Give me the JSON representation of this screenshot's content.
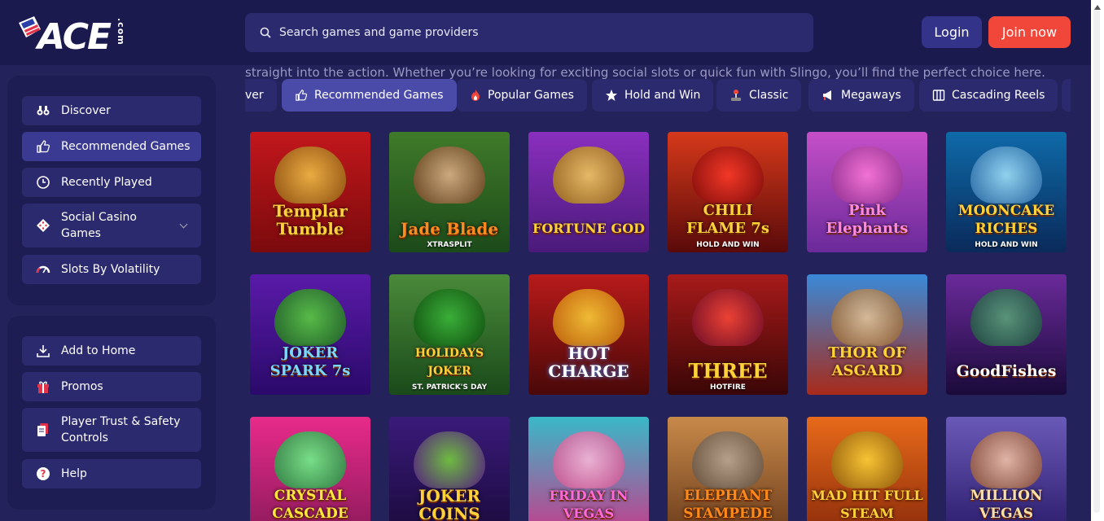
{
  "header": {
    "logo_text": "ACE",
    "logo_suffix": ".com",
    "search_placeholder": "Search games and game providers",
    "login_label": "Login",
    "join_label": "Join now"
  },
  "sidebar": {
    "primary": [
      {
        "label": "Discover",
        "icon": "binoculars-icon"
      },
      {
        "label": "Recommended Games",
        "icon": "thumbs-up-icon",
        "active": true
      },
      {
        "label": "Recently Played",
        "icon": "clock-icon"
      },
      {
        "label": "Social Casino Games",
        "icon": "dice-icon",
        "expandable": true
      },
      {
        "label": "Slots By Volatility",
        "icon": "gauge-icon"
      }
    ],
    "secondary": [
      {
        "label": "Add to Home",
        "icon": "download-icon"
      },
      {
        "label": "Promos",
        "icon": "gift-icon"
      },
      {
        "label": "Player Trust & Safety Controls",
        "icon": "document-icon"
      },
      {
        "label": "Help",
        "icon": "help-icon"
      }
    ]
  },
  "intro_text": "straight into the action. Whether you’re looking for exciting social slots or quick fun with Slingo, you’ll find the perfect choice here.",
  "tabs": [
    {
      "label": "ver",
      "icon": ""
    },
    {
      "label": "Recommended Games",
      "icon": "thumbs-up-icon",
      "active": true
    },
    {
      "label": "Popular Games",
      "icon": "flame-icon"
    },
    {
      "label": "Hold and Win",
      "icon": "star-icon"
    },
    {
      "label": "Classic",
      "icon": "joystick-icon"
    },
    {
      "label": "Megaways",
      "icon": "megaphone-icon"
    },
    {
      "label": "Cascading Reels",
      "icon": "columns-icon"
    }
  ],
  "games": [
    {
      "title": "Templar Tumble",
      "sub": ""
    },
    {
      "title": "Jade Blade",
      "sub": "XTRASPLIT"
    },
    {
      "title": "FORTUNE GOD",
      "sub": ""
    },
    {
      "title": "CHILI FLAME 7s",
      "sub": "HOLD AND WIN"
    },
    {
      "title": "Pink Elephants",
      "sub": ""
    },
    {
      "title": "MOONCAKE RICHES",
      "sub": "HOLD AND WIN"
    },
    {
      "title": "JOKER SPARK 7s",
      "sub": ""
    },
    {
      "title": "HOLIDAYS JOKER",
      "sub": "ST. PATRICK'S DAY"
    },
    {
      "title": "HOT CHARGE",
      "sub": ""
    },
    {
      "title": "THREE",
      "sub": "HOTFIRE"
    },
    {
      "title": "THOR OF ASGARD",
      "sub": ""
    },
    {
      "title": "GoodFishes",
      "sub": ""
    },
    {
      "title": "CRYSTAL CASCADE",
      "sub": ""
    },
    {
      "title": "JOKER COINS",
      "sub": ""
    },
    {
      "title": "FRIDAY IN VEGAS",
      "sub": ""
    },
    {
      "title": "ELEPHANT STAMPEDE",
      "sub": ""
    },
    {
      "title": "MAD HIT FULL STEAM",
      "sub": ""
    },
    {
      "title": "MILLION VEGAS",
      "sub": ""
    }
  ],
  "colors": {
    "background": "#23225a",
    "header": "#1b1a4f",
    "accent": "#f0473a",
    "tab_active": "#4a4aa8"
  }
}
